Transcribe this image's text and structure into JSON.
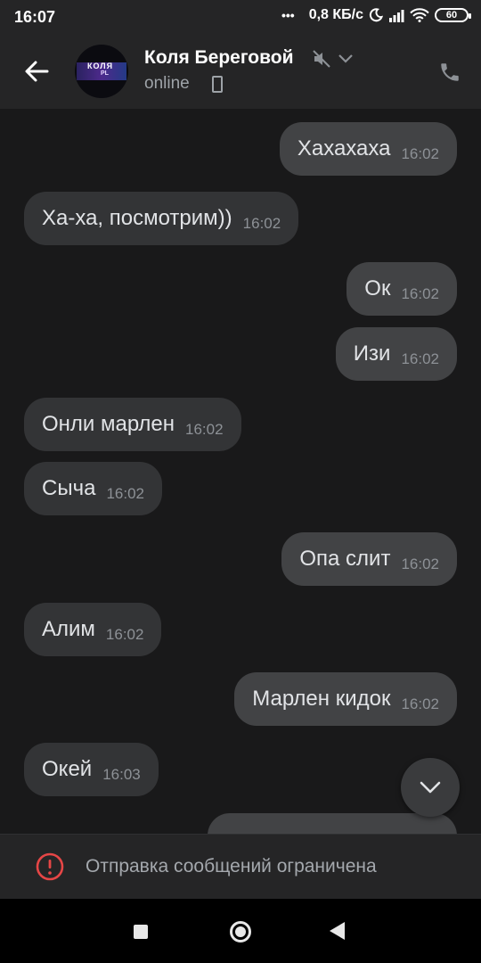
{
  "statusbar": {
    "time": "16:07",
    "dots": "•••",
    "speed": "0,8 КБ/с",
    "battery": "60"
  },
  "header": {
    "contact_name": "Коля Береговой",
    "status": "online",
    "avatar_text_1": "КОЛЯ",
    "avatar_text_2": "PL"
  },
  "messages": [
    {
      "dir": "out",
      "text": "Хахахаха",
      "time": "16:02"
    },
    {
      "dir": "in",
      "text": "Ха-ха, посмотрим))",
      "time": "16:02"
    },
    {
      "dir": "out",
      "text": "Ок",
      "time": "16:02"
    },
    {
      "dir": "out",
      "text": "Изи",
      "time": "16:02"
    },
    {
      "dir": "in",
      "text": "Онли марлен",
      "time": "16:02"
    },
    {
      "dir": "in",
      "text": "Сыча",
      "time": "16:02"
    },
    {
      "dir": "out",
      "text": "Опа слит",
      "time": "16:02"
    },
    {
      "dir": "in",
      "text": "Алим",
      "time": "16:02"
    },
    {
      "dir": "out",
      "text": "Марлен кидок",
      "time": "16:02"
    },
    {
      "dir": "in",
      "text": "Окей",
      "time": "16:03"
    }
  ],
  "restriction": {
    "text": "Отправка сообщений ограничена"
  },
  "colors": {
    "background": "#19191a",
    "bubble_in": "#333436",
    "bubble_out": "#424345",
    "warning": "#e64646"
  },
  "icons": {
    "back": "arrow-left-icon",
    "mute": "muted-speaker-icon",
    "call": "phone-icon",
    "scroll": "chevron-down-icon",
    "warning": "exclamation-circle-icon"
  }
}
